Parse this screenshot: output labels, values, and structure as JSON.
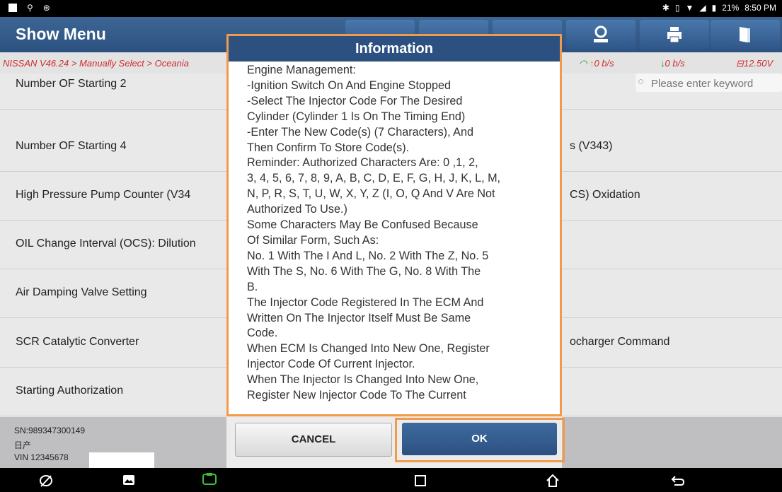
{
  "status": {
    "time": "8:50 PM",
    "battery": "21%",
    "left_icons": [
      "image-icon",
      "usb-icon",
      "circle-icon"
    ],
    "right_icons": [
      "bluetooth-icon",
      "vibrate-icon",
      "wifi-icon",
      "signal-icon",
      "battery-icon"
    ]
  },
  "header": {
    "title": "Show Menu",
    "toolbar_icons": [
      "toolbar-icon-1",
      "toolbar-icon-2",
      "toolbar-icon-3",
      "profile-icon",
      "print-icon",
      "exit-icon"
    ]
  },
  "breadcrumb": "NISSAN V46.24 > Manually Select > Oceania",
  "stats": {
    "upload": "0 b/s",
    "download": "0 b/s",
    "voltage": "12.50V"
  },
  "search": {
    "placeholder": "Please enter keyword"
  },
  "list": {
    "rows": [
      {
        "left": "Number OF Starting 2",
        "right": ""
      },
      {
        "left": "Number OF Starting 4",
        "right": "s (V343)"
      },
      {
        "left": "High Pressure Pump Counter (V34",
        "right": "CS) Oxidation"
      },
      {
        "left": "OIL Change Interval (OCS): Dilution",
        "right": ""
      },
      {
        "left": "Air Damping Valve Setting",
        "right": ""
      },
      {
        "left": "SCR Catalytic Converter",
        "right": "ocharger Command"
      },
      {
        "left": "Starting Authorization",
        "right": ""
      }
    ]
  },
  "footer": {
    "sn": "SN:989347300149",
    "brand": "日产",
    "vin": "VIN 12345678"
  },
  "dialog": {
    "title": "Information",
    "lines": [
      "Engine Management:",
      "-Ignition Switch On And Engine Stopped",
      "-Select The Injector Code For The Desired",
      "Cylinder (Cylinder 1 Is On The Timing End)",
      "-Enter The New Code(s) (7 Characters), And",
      "Then Confirm To Store Code(s).",
      "Reminder: Authorized Characters Are: 0 ,1, 2,",
      "3, 4, 5, 6, 7, 8, 9, A, B, C, D, E, F, G, H, J, K, L, M,",
      "N, P, R, S, T, U, W, X, Y, Z (I, O, Q And V Are Not",
      "Authorized To Use.)",
      "Some Characters May Be Confused Because",
      "Of Similar Form, Such As:",
      "No. 1 With The I And L, No. 2 With The Z, No. 5",
      "With The S, No. 6 With The G, No. 8 With The",
      "B.",
      "The Injector Code Registered In The ECM And",
      "Written On The Injector Itself Must Be Same",
      "Code.",
      "When ECM Is Changed Into New One,  Register",
      "Injector Code Of Current Injector.",
      "When The Injector Is Changed Into New One,",
      "Register New Injector Code To The Current"
    ],
    "cancel_label": "CANCEL",
    "ok_label": "OK"
  },
  "navbar": {
    "icons": [
      "browser-icon",
      "gallery-icon",
      "vci-icon",
      "recent-apps-icon",
      "home-icon",
      "back-icon"
    ]
  }
}
